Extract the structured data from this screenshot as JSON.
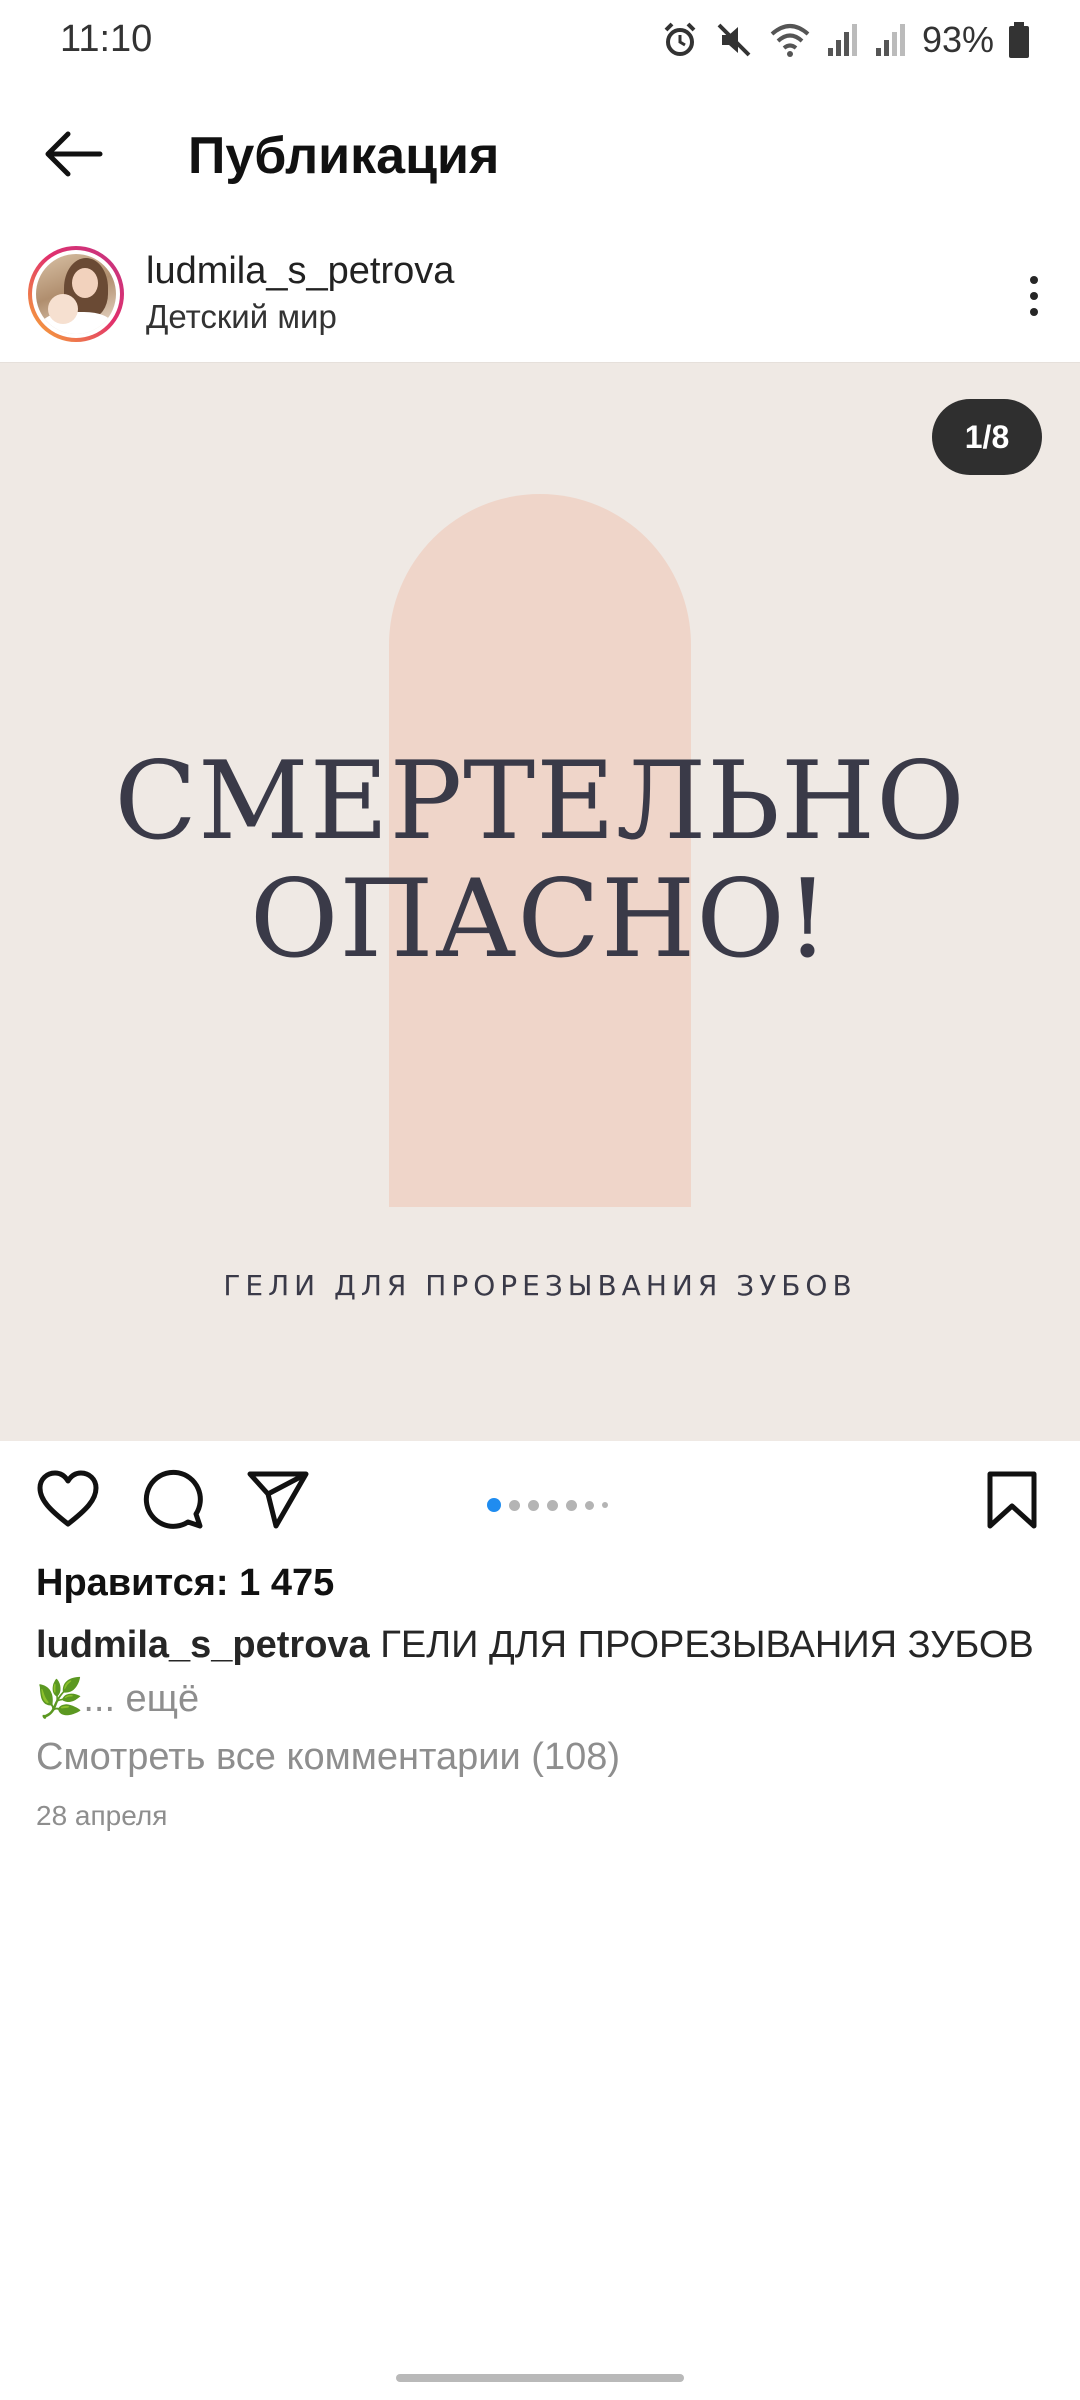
{
  "status_bar": {
    "time": "11:10",
    "battery": "93%",
    "icons": [
      "alarm-icon",
      "mute-icon",
      "wifi-icon",
      "signal-icon",
      "signal-icon",
      "battery-icon"
    ]
  },
  "header": {
    "title": "Публикация",
    "back_icon": "arrow-left-icon"
  },
  "post": {
    "username": "ludmila_s_petrova",
    "location": "Детский мир",
    "more_icon": "more-vertical-icon",
    "image": {
      "counter": "1/8",
      "headline_line1": "СМЕРТЕЛЬНО",
      "headline_line2": "ОПАСНО!",
      "subline": "ГЕЛИ ДЛЯ ПРОРЕЗЫВАНИЯ ЗУБОВ",
      "background_color": "#efe9e4",
      "arch_color": "#efd5c9"
    },
    "actions": {
      "like_icon": "heart-icon",
      "comment_icon": "comment-icon",
      "share_icon": "send-icon",
      "save_icon": "bookmark-icon"
    },
    "carousel": {
      "active_index": 0,
      "active_color": "#1f8cf0"
    },
    "likes": "Нравится: 1 475",
    "caption": {
      "user": "ludmila_s_petrova",
      "text": " ГЕЛИ ДЛЯ ПРОРЕЗЫВАНИЯ ЗУБОВ",
      "emoji": "🌿",
      "more": "... ещё"
    },
    "view_comments": "Смотреть все комментарии (108)",
    "date": "28 апреля"
  }
}
